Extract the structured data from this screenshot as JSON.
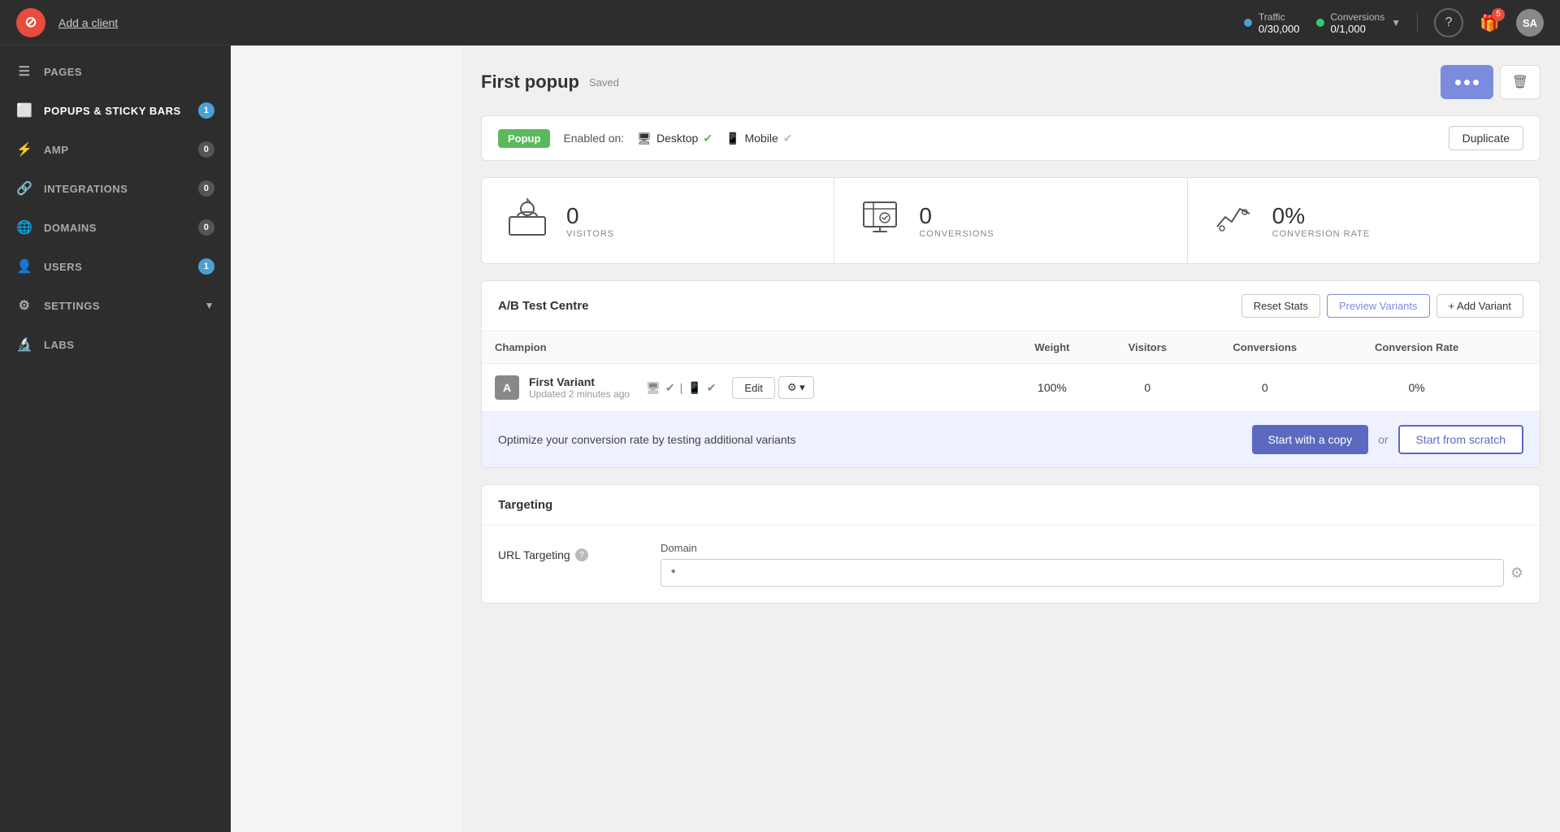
{
  "app": {
    "logo": "⊘",
    "add_client_label": "Add a client"
  },
  "topbar": {
    "traffic_label": "Traffic",
    "traffic_value": "0/30,000",
    "conversions_label": "Conversions",
    "conversions_value": "0/1,000",
    "help_icon": "?",
    "gift_badge": "5",
    "avatar": "SA"
  },
  "sidebar": {
    "items": [
      {
        "id": "pages",
        "label": "PAGES",
        "badge": null,
        "icon": "📄"
      },
      {
        "id": "popups",
        "label": "POPUPS & STICKY BARS",
        "badge": 1,
        "icon": "🔲",
        "active": true
      },
      {
        "id": "amp",
        "label": "AMP",
        "badge": 0,
        "icon": "⚡"
      },
      {
        "id": "integrations",
        "label": "INTEGRATIONS",
        "badge": 0,
        "icon": "🔗"
      },
      {
        "id": "domains",
        "label": "DOMAINS",
        "badge": 0,
        "icon": "🌐"
      },
      {
        "id": "users",
        "label": "USERS",
        "badge": 1,
        "icon": "👤"
      },
      {
        "id": "settings",
        "label": "SETTINGS",
        "badge": null,
        "icon": "⚙",
        "has_chevron": true
      },
      {
        "id": "labs",
        "label": "LABS",
        "badge": null,
        "icon": "🔬"
      }
    ]
  },
  "page": {
    "title": "First popup",
    "saved_label": "Saved",
    "popup_tag": "Popup",
    "enabled_label": "Enabled on:",
    "desktop_label": "Desktop",
    "mobile_label": "Mobile",
    "duplicate_label": "Duplicate"
  },
  "stats": [
    {
      "num": "0",
      "label": "VISITORS"
    },
    {
      "num": "0",
      "label": "CONVERSIONS"
    },
    {
      "num": "0%",
      "label": "CONVERSION RATE"
    }
  ],
  "ab_test": {
    "title": "A/B Test Centre",
    "reset_stats_label": "Reset Stats",
    "preview_variants_label": "Preview Variants",
    "add_variant_label": "+ Add Variant",
    "columns": [
      "Champion",
      "Weight",
      "Visitors",
      "Conversions",
      "Conversion Rate"
    ],
    "rows": [
      {
        "letter": "A",
        "name": "First Variant",
        "updated": "Updated 2 minutes ago",
        "weight": "100%",
        "visitors": "0",
        "conversions": "0",
        "conversion_rate": "0%"
      }
    ],
    "cta_text": "Optimize your conversion rate by testing additional variants",
    "start_with_copy_label": "Start with a copy",
    "or_label": "or",
    "start_from_scratch_label": "Start from scratch"
  },
  "targeting": {
    "title": "Targeting",
    "url_targeting_label": "URL Targeting",
    "domain_label": "Domain",
    "domain_value": "*"
  }
}
